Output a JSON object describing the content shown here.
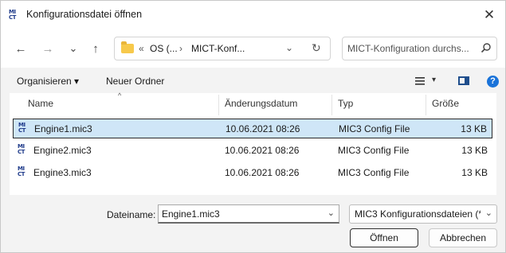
{
  "window": {
    "title": "Konfigurationsdatei öffnen",
    "app_icon": "MIC3-icon",
    "close_glyph": "✕"
  },
  "nav": {
    "back_glyph": "←",
    "forward_glyph": "→",
    "recent_glyph": "⌄",
    "up_glyph": "↑",
    "path_prefix": "«",
    "path_parts": [
      "OS (...",
      "MICT-Konf..."
    ],
    "path_sep": "›",
    "dropdown_glyph": "⌄",
    "refresh_glyph": "↻",
    "search_placeholder": "MICT-Konfiguration durchs..."
  },
  "commands": {
    "organize_label": "Organisieren",
    "organize_dd": "▾",
    "new_folder_label": "Neuer Ordner",
    "view_dd": "▾",
    "help_glyph": "?"
  },
  "columns": {
    "name": "Name",
    "date": "Änderungsdatum",
    "type": "Typ",
    "size": "Größe",
    "sort_glyph": "^"
  },
  "files": [
    {
      "name": "Engine1.mic3",
      "date": "10.06.2021 08:26",
      "type": "MIC3 Config File",
      "size": "13 KB",
      "selected": true
    },
    {
      "name": "Engine2.mic3",
      "date": "10.06.2021 08:26",
      "type": "MIC3 Config File",
      "size": "13 KB",
      "selected": false
    },
    {
      "name": "Engine3.mic3",
      "date": "10.06.2021 08:26",
      "type": "MIC3 Config File",
      "size": "13 KB",
      "selected": false
    }
  ],
  "footer": {
    "filename_label": "Dateiname:",
    "filename_value": "Engine1.mic3",
    "filename_dd": "⌄",
    "filetype_value": "MIC3 Konfigurationsdateien (*.",
    "filetype_dd": "⌄",
    "open_label": "Öffnen",
    "cancel_label": "Abbrechen"
  }
}
